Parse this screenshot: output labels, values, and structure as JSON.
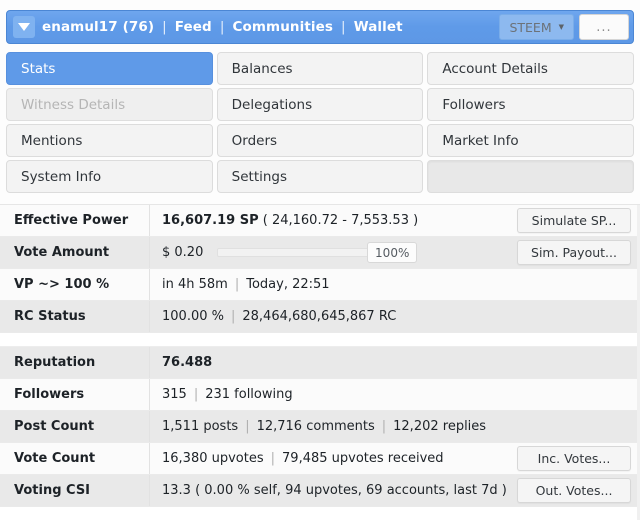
{
  "header": {
    "caret_icon": "chevron-down-icon",
    "username": "enamul17 (76)",
    "nav": [
      {
        "label": "Feed"
      },
      {
        "label": "Communities"
      },
      {
        "label": "Wallet"
      }
    ],
    "separator": "|",
    "currency_selector": {
      "label": "STEEM",
      "caret": "▾"
    },
    "overflow_button": "...",
    "bg_color": "#5f9ae8"
  },
  "tabs": [
    {
      "label": "Stats",
      "state": "active"
    },
    {
      "label": "Balances",
      "state": "normal"
    },
    {
      "label": "Account Details",
      "state": "normal"
    },
    {
      "label": "Witness Details",
      "state": "disabled"
    },
    {
      "label": "Delegations",
      "state": "normal"
    },
    {
      "label": "Followers",
      "state": "normal"
    },
    {
      "label": "Mentions",
      "state": "normal"
    },
    {
      "label": "Orders",
      "state": "normal"
    },
    {
      "label": "Market Info",
      "state": "normal"
    },
    {
      "label": "System Info",
      "state": "normal"
    },
    {
      "label": "Settings",
      "state": "normal"
    },
    {
      "label": "",
      "state": "empty"
    }
  ],
  "stats": {
    "effective_power": {
      "label": "Effective Power",
      "value_bold": "16,607.19 SP",
      "value_rest": "( 24,160.72 - 7,553.53 )",
      "button": "Simulate SP..."
    },
    "vote_amount": {
      "label": "Vote Amount",
      "value": "$ 0.20",
      "slider_percent": "100%",
      "slider_value": 100,
      "button": "Sim. Payout..."
    },
    "vp_to_100": {
      "label": "VP ~> 100 %",
      "time_remaining": "in 4h 58m",
      "separator": "|",
      "eta": "Today, 22:51"
    },
    "rc_status": {
      "label": "RC Status",
      "percent": "100.00 %",
      "separator": "|",
      "amount": "28,464,680,645,867 RC"
    },
    "reputation": {
      "label": "Reputation",
      "value": "76.488"
    },
    "followers": {
      "label": "Followers",
      "count": "315",
      "separator": "|",
      "following": "231 following"
    },
    "post_count": {
      "label": "Post Count",
      "posts": "1,511 posts",
      "sep1": "|",
      "comments": "12,716 comments",
      "sep2": "|",
      "replies": "12,202 replies"
    },
    "vote_count": {
      "label": "Vote Count",
      "given": "16,380 upvotes",
      "separator": "|",
      "received": "79,485 upvotes received",
      "button": "Inc. Votes..."
    },
    "voting_csi": {
      "label": "Voting CSI",
      "value": "13.3 ( 0.00 % self, 94 upvotes, 69 accounts, last 7d )",
      "button": "Out. Votes..."
    }
  }
}
